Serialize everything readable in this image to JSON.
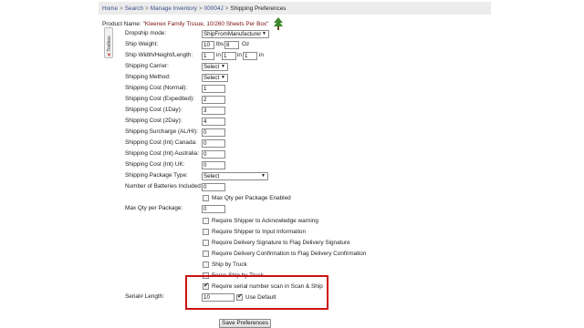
{
  "breadcrumb": {
    "items": [
      "Home",
      "Search",
      "Manage Inventory",
      "00004J"
    ],
    "separator": ">",
    "current": "Shipping Preferences"
  },
  "product": {
    "label": "Product Name:",
    "value": "\"Kleenex Family Tissue, 10/260 Sheets Per Box\""
  },
  "toolbox": {
    "label": "Toolbox",
    "close_glyph": "✕"
  },
  "form": {
    "dropship_mode": {
      "label": "Dropship mode:",
      "value": "ShipFromManufacturer"
    },
    "ship_weight": {
      "label": "Ship Weight:",
      "lbs": "10",
      "lbs_unit": "lbs",
      "oz": "8",
      "oz_unit": "Oz"
    },
    "ship_dims": {
      "label": "Ship Width/Height/Length:",
      "width": "1",
      "height": "1",
      "length": "1",
      "unit": "in"
    },
    "shipping_carrier": {
      "label": "Shipping Carrier:",
      "value": "Select"
    },
    "shipping_method": {
      "label": "Shipping Method:",
      "value": "Select"
    },
    "cost_normal": {
      "label": "Shipping Cost (Normal):",
      "value": "1"
    },
    "cost_expedited": {
      "label": "Shipping Cost (Expedited):",
      "value": "2"
    },
    "cost_1day": {
      "label": "Shipping Cost (1Day):",
      "value": "3"
    },
    "cost_2day": {
      "label": "Shipping Cost (2Day):",
      "value": "4"
    },
    "surcharge": {
      "label": "Shipping Surcharge (AL/HI):",
      "value": "0"
    },
    "cost_canada": {
      "label": "Shipping Cost (Int) Canada:",
      "value": "0"
    },
    "cost_australia": {
      "label": "Shipping Cost (Int) Australia:",
      "value": "0"
    },
    "cost_uk": {
      "label": "Shipping Cost (Int) UK:",
      "value": "0"
    },
    "package_type": {
      "label": "Shipping Package Type:",
      "value": "Select"
    },
    "batteries": {
      "label": "Number of Batteries Included:",
      "value": "0"
    },
    "max_qty_enabled": {
      "label": "Max Qty per Package Enabled",
      "checked": false
    },
    "max_qty": {
      "label": "Max Qty per Package:",
      "value": "0"
    },
    "options": [
      {
        "label": "Require Shipper to Acknowledge warning",
        "checked": false
      },
      {
        "label": "Require Shipper to Input Information",
        "checked": false
      },
      {
        "label": "Require Delivery Signature to Flag Delivery Signature",
        "checked": false
      },
      {
        "label": "Require Delivery Confirmation to Flag Delivery Confirmation",
        "checked": false
      },
      {
        "label": "Ship by Truck",
        "checked": false
      },
      {
        "label": "Force Ship by Truck",
        "checked": false
      },
      {
        "label": "Require serial number scan in Scan & Ship",
        "checked": true
      }
    ],
    "serial_length": {
      "label": "Serial# Length:",
      "value": "10",
      "use_default_label": "Use Default",
      "use_default_checked": true
    }
  },
  "save_button": "Save Preferences",
  "colors": {
    "highlight": "#cc1111",
    "link": "#3a4f8c",
    "product_name": "#7a1010"
  }
}
